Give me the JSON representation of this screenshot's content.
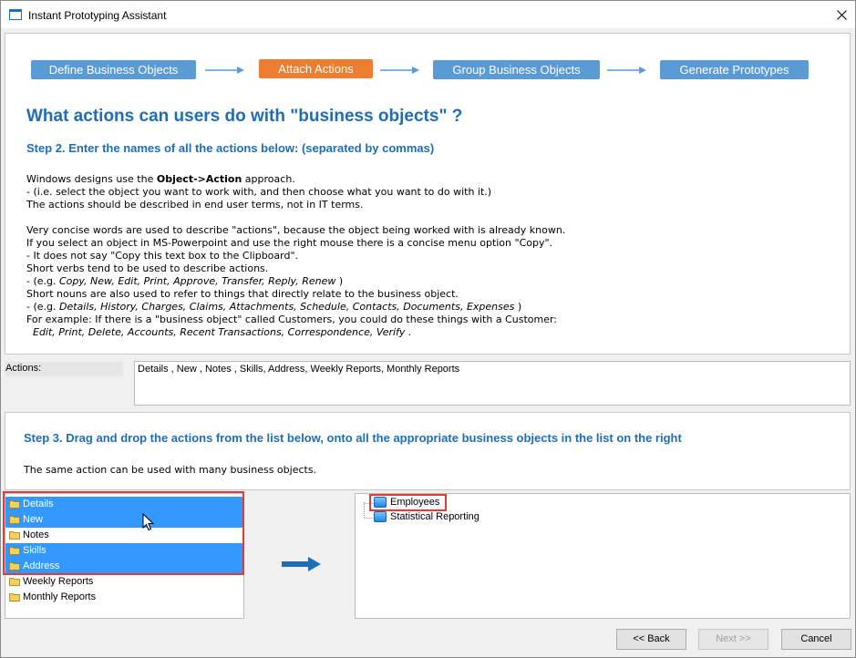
{
  "window": {
    "title": "Instant Prototyping Assistant",
    "icon": "app-window-icon"
  },
  "wizard": {
    "steps": [
      {
        "label": "Define Business Objects",
        "state": "inactive",
        "color": "#5a9bd5"
      },
      {
        "label": "Attach Actions",
        "state": "active",
        "color": "#ed7d31"
      },
      {
        "label": "Group Business Objects",
        "state": "inactive",
        "color": "#5a9bd5"
      },
      {
        "label": "Generate Prototypes",
        "state": "inactive",
        "color": "#5a9bd5"
      }
    ]
  },
  "content": {
    "heading": "What actions can users do with \"business objects\" ?",
    "step2": "Step 2. Enter the names of all the actions below: (separated by commas)",
    "intro": {
      "line1_pre": "Windows designs use the ",
      "line1_bold": "Object->Action",
      "line1_post": " approach.",
      "line2": "- (i.e. select the object you want to work with, and then choose what you want to do with it.)",
      "line3": "The actions should be described in end user terms, not in IT terms."
    },
    "concise": {
      "line1": "Very concise words are used to describe \"actions\", because the object being worked with is already known.",
      "line2": "If you select an object in MS-Powerpoint and use the right mouse there is a concise menu option \"Copy\".",
      "line3": "- It does not say \"Copy this text box to the Clipboard\".",
      "line4": "Short verbs tend to be used to describe actions.",
      "verbs_pre": "- (e.g. ",
      "verbs": "Copy, New, Edit, Print, Approve, Transfer, Reply, Renew",
      "verbs_post": " )",
      "line6": "Short nouns are also used to refer to things that directly relate to the business object.",
      "nouns_pre": "- (e.g. ",
      "nouns": "Details, History, Charges, Claims, Attachments, Schedule, Contacts, Documents, Expenses",
      "nouns_post": " )",
      "line8": "For example: If there is a \"business object\" called Customers, you could do these things with a Customer:",
      "example": "  Edit, Print, Delete, Accounts, Recent Transactions, Correspondence, Verify .",
      "example_indent": "  "
    }
  },
  "actions": {
    "label": "Actions:",
    "value": "Details , New , Notes , Skills, Address, Weekly Reports, Monthly Reports"
  },
  "step3": {
    "heading": "Step 3. Drag and drop the actions from the list below, onto all the appropriate business objects in the list on the right",
    "text": "The same action can be used with many business objects."
  },
  "action_list": [
    {
      "label": "Details",
      "selected": true
    },
    {
      "label": "New",
      "selected": true
    },
    {
      "label": "Notes",
      "selected": false
    },
    {
      "label": "Skills",
      "selected": true
    },
    {
      "label": "Address",
      "selected": true
    },
    {
      "label": "Weekly Reports",
      "selected": false
    },
    {
      "label": "Monthly Reports",
      "selected": false
    }
  ],
  "business_objects": [
    {
      "label": "Employees",
      "highlighted": true
    },
    {
      "label": "Statistical Reporting",
      "highlighted": false
    }
  ],
  "buttons": {
    "back": "<< Back",
    "next": "Next >>",
    "cancel": "Cancel"
  },
  "colors": {
    "accent_blue": "#1f6eb5",
    "step_blue": "#5a9bd5",
    "step_active": "#ed7d31",
    "selection": "#3399ff",
    "highlight_red": "#e03c3c"
  }
}
